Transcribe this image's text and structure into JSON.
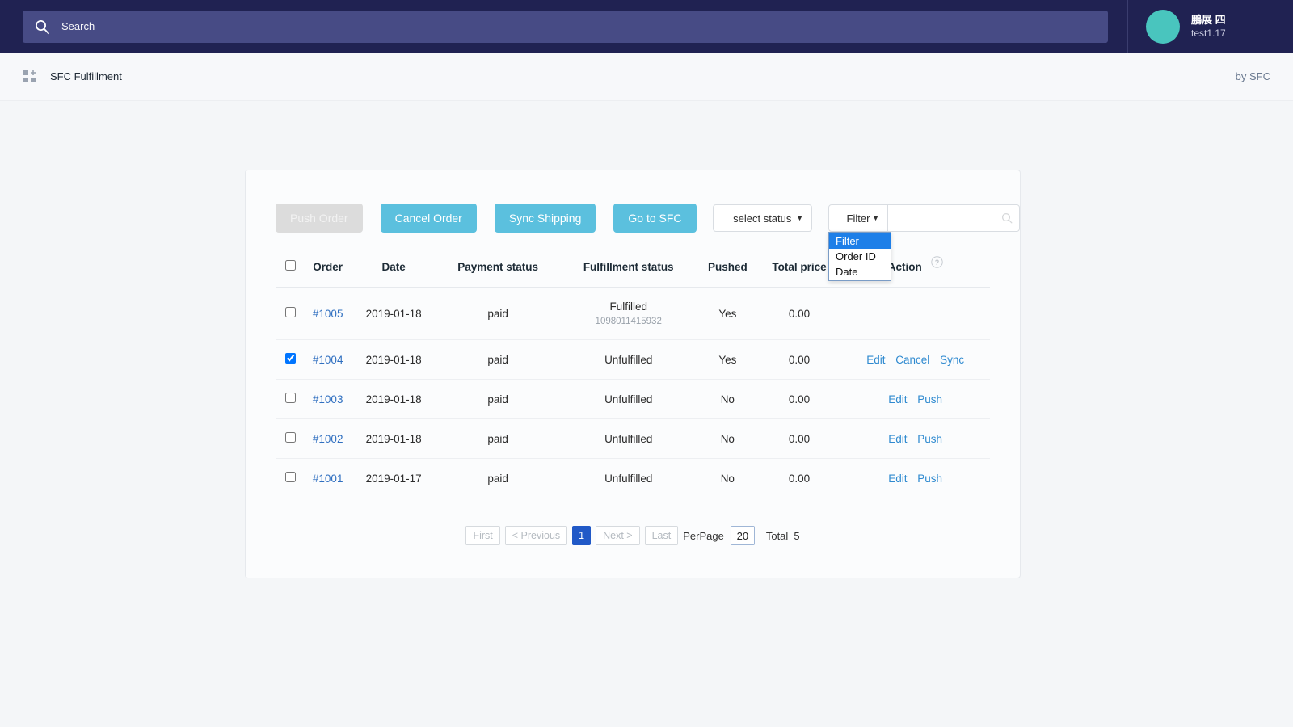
{
  "topbar": {
    "search_placeholder": "Search",
    "search_icon": "search-icon",
    "user": {
      "name": "鵬展 四",
      "account": "test1.17"
    }
  },
  "subheader": {
    "app_icon": "apps-add-icon",
    "title": "SFC Fulfillment",
    "credit": "by SFC"
  },
  "toolbar": {
    "push_order": "Push Order",
    "cancel_order": "Cancel Order",
    "sync_shipping": "Sync Shipping",
    "go_to_sfc": "Go to SFC",
    "status_select": {
      "value": "select status",
      "caret": "▼"
    },
    "filter_select": {
      "value": "Filter",
      "caret": "▼",
      "open": true,
      "options": [
        "Filter",
        "Order ID",
        "Date"
      ],
      "selected_index": 0
    },
    "filter_input": {
      "value": "",
      "icon": "search-icon"
    }
  },
  "table": {
    "headers": [
      "",
      "Order",
      "Date",
      "Payment status",
      "Fulfillment status",
      "Pushed",
      "Total price",
      "Action"
    ],
    "action_help_icon": "question-circle-icon",
    "header_checkbox_checked": false,
    "rows": [
      {
        "checked": false,
        "order": "#1005",
        "date": "2019-01-18",
        "payment_status": "paid",
        "fulfillment_status": "Fulfilled",
        "tracking": "1098011415932",
        "pushed": "Yes",
        "total_price": "0.00",
        "actions": []
      },
      {
        "checked": true,
        "order": "#1004",
        "date": "2019-01-18",
        "payment_status": "paid",
        "fulfillment_status": "Unfulfilled",
        "tracking": "",
        "pushed": "Yes",
        "total_price": "0.00",
        "actions": [
          "Edit",
          "Cancel",
          "Sync"
        ]
      },
      {
        "checked": false,
        "order": "#1003",
        "date": "2019-01-18",
        "payment_status": "paid",
        "fulfillment_status": "Unfulfilled",
        "tracking": "",
        "pushed": "No",
        "total_price": "0.00",
        "actions": [
          "Edit",
          "Push"
        ]
      },
      {
        "checked": false,
        "order": "#1002",
        "date": "2019-01-18",
        "payment_status": "paid",
        "fulfillment_status": "Unfulfilled",
        "tracking": "",
        "pushed": "No",
        "total_price": "0.00",
        "actions": [
          "Edit",
          "Push"
        ]
      },
      {
        "checked": false,
        "order": "#1001",
        "date": "2019-01-17",
        "payment_status": "paid",
        "fulfillment_status": "Unfulfilled",
        "tracking": "",
        "pushed": "No",
        "total_price": "0.00",
        "actions": [
          "Edit",
          "Push"
        ]
      }
    ]
  },
  "pagination": {
    "first": "First",
    "previous": "< Previous",
    "current_page": "1",
    "next": "Next >",
    "last": "Last",
    "perpage_label": "PerPage",
    "perpage_value": "20",
    "total_label": "Total",
    "total_value": "5"
  },
  "colors": {
    "topbar_bg": "#202252",
    "search_bg": "#474b85",
    "avatar": "#49c5be",
    "primary_button": "#5bc0de",
    "disabled_button": "#dcdcdc",
    "link": "#2f8ad0",
    "dropdown_selected": "#1e7fe8",
    "page_active": "#2159c7"
  }
}
